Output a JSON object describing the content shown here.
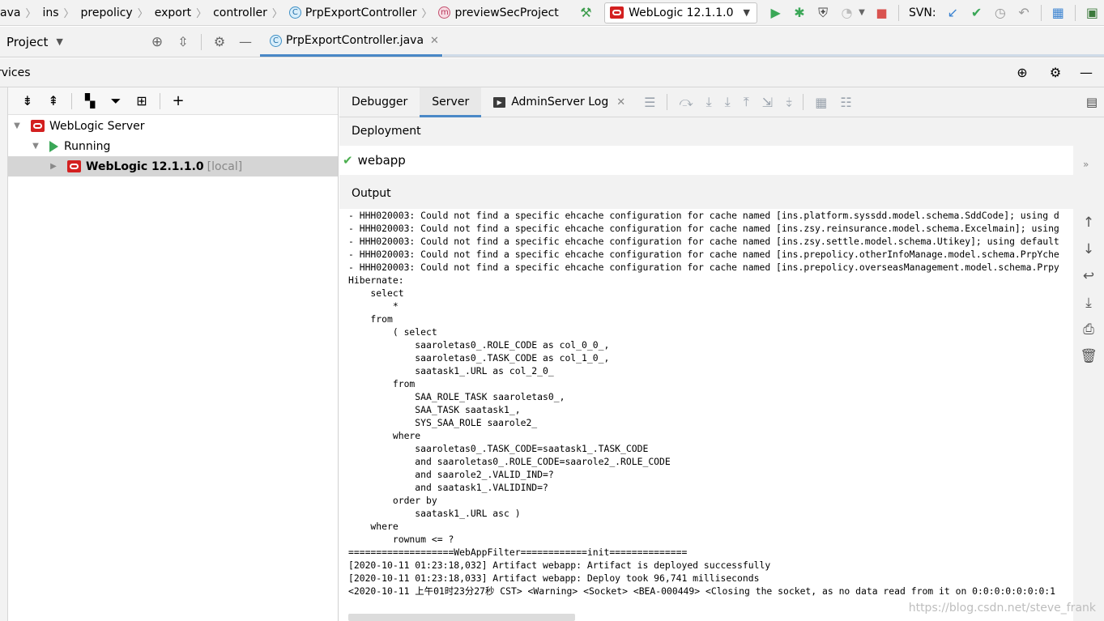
{
  "breadcrumbs": [
    "ava",
    "ins",
    "prepolicy",
    "export",
    "controller"
  ],
  "breadcrumb_class": {
    "icon": "C",
    "label": "PrpExportController"
  },
  "breadcrumb_method": {
    "icon": "m",
    "label": "previewSecProject"
  },
  "run_config": {
    "label": "WebLogic 12.1.1.0"
  },
  "svn_label": "SVN:",
  "project_panel": {
    "title": "Project"
  },
  "editor_tab": {
    "icon": "C",
    "label": "PrpExportController.java"
  },
  "services": {
    "title": "rvices"
  },
  "tree": {
    "server": "WebLogic Server",
    "running": "Running",
    "instance": "WebLogic 12.1.1.0",
    "instance_suffix": "[local]"
  },
  "tabs": {
    "debugger": "Debugger",
    "server": "Server",
    "admin_log": "AdminServer Log",
    "log_icon": "▶"
  },
  "deployment": {
    "label": "Deployment",
    "artifact": "webapp"
  },
  "output": {
    "label": "Output",
    "text": "- HHH020003: Could not find a specific ehcache configuration for cache named [ins.platform.syssdd.model.schema.SddCode]; using d\n- HHH020003: Could not find a specific ehcache configuration for cache named [ins.zsy.reinsurance.model.schema.Excelmain]; using\n- HHH020003: Could not find a specific ehcache configuration for cache named [ins.zsy.settle.model.schema.Utikey]; using default\n- HHH020003: Could not find a specific ehcache configuration for cache named [ins.prepolicy.otherInfoManage.model.schema.PrpYche\n- HHH020003: Could not find a specific ehcache configuration for cache named [ins.prepolicy.overseasManagement.model.schema.Prpy\nHibernate:\n    select\n        *\n    from\n        ( select\n            saaroletas0_.ROLE_CODE as col_0_0_,\n            saaroletas0_.TASK_CODE as col_1_0_,\n            saatask1_.URL as col_2_0_\n        from\n            SAA_ROLE_TASK saaroletas0_,\n            SAA_TASK saatask1_,\n            SYS_SAA_ROLE saarole2_\n        where\n            saaroletas0_.TASK_CODE=saatask1_.TASK_CODE\n            and saaroletas0_.ROLE_CODE=saarole2_.ROLE_CODE\n            and saarole2_.VALID_IND=?\n            and saatask1_.VALIDIND=?\n        order by\n            saatask1_.URL asc )\n    where\n        rownum <= ?\n===================WebAppFilter============init==============\n[2020-10-11 01:23:18,032] Artifact webapp: Artifact is deployed successfully\n[2020-10-11 01:23:18,033] Artifact webapp: Deploy took 96,741 milliseconds\n<2020-10-11 上午01时23分27秒 CST> <Warning> <Socket> <BEA-000449> <Closing the socket, as no data read from it on 0:0:0:0:0:0:0:1"
  },
  "watermark": "https://blog.csdn.net/steve_frank",
  "icons": {
    "build": "hammer-icon",
    "run": "run-icon",
    "debug": "debug-icon",
    "stop": "stop-icon",
    "scroll_up": "arrow-up-icon",
    "scroll_down": "arrow-down-icon",
    "wrap": "soft-wrap-icon",
    "scroll_end": "scroll-to-end-icon",
    "print": "print-icon",
    "clear": "trash-icon"
  }
}
